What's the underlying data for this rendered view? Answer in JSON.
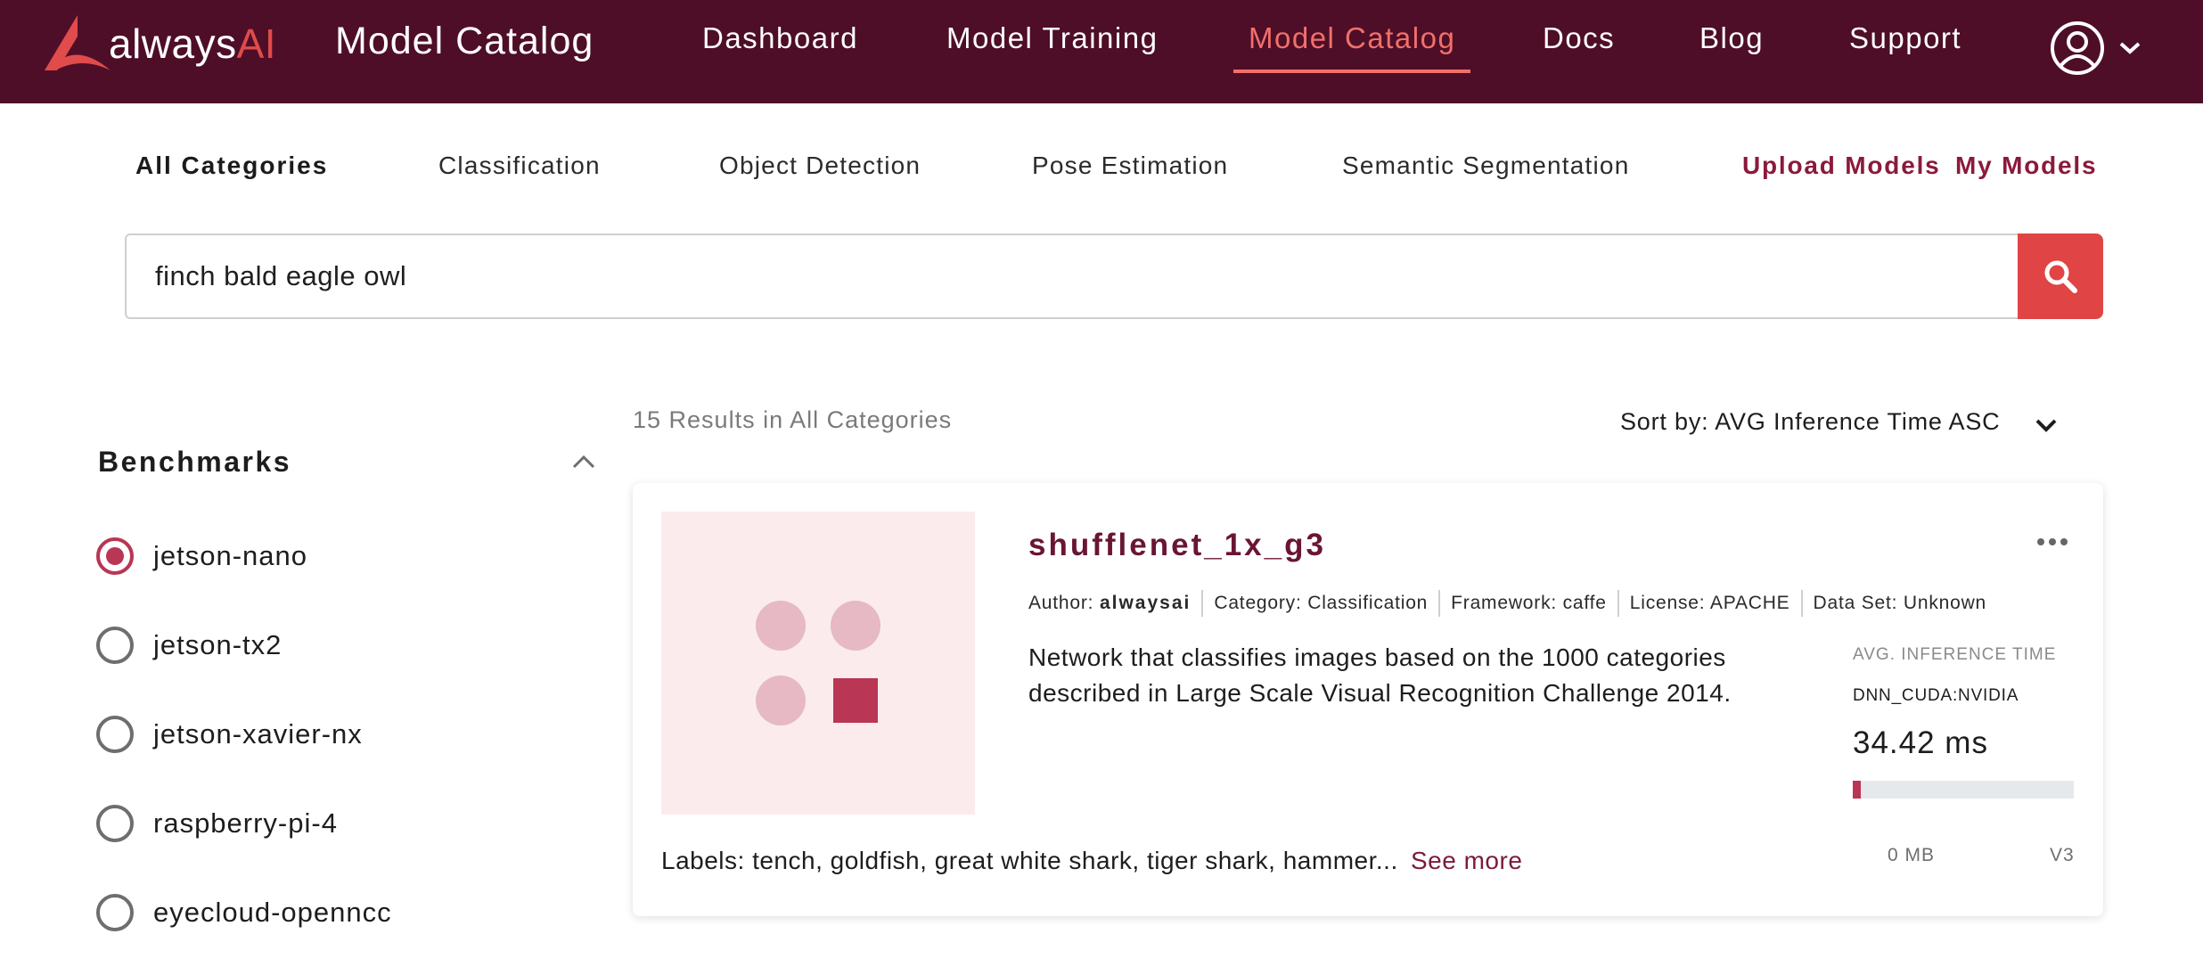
{
  "brand": {
    "name_main": "always",
    "name_accent": "AI"
  },
  "header": {
    "title": "Model Catalog",
    "nav": [
      "Dashboard",
      "Model Training",
      "Model Catalog",
      "Docs",
      "Blog",
      "Support"
    ],
    "active_nav": "Model Catalog"
  },
  "categories": {
    "items": [
      "All Categories",
      "Classification",
      "Object Detection",
      "Pose Estimation",
      "Semantic Segmentation"
    ],
    "active": "All Categories",
    "upload_label": "Upload Models",
    "my_models_label": "My Models"
  },
  "search": {
    "value": "finch bald eagle owl"
  },
  "sidebar": {
    "title": "Benchmarks",
    "options": [
      "jetson-nano",
      "jetson-tx2",
      "jetson-xavier-nx",
      "raspberry-pi-4",
      "eyecloud-openncc"
    ],
    "selected": "jetson-nano"
  },
  "results": {
    "count_text": "15 Results in All Categories",
    "sort_text": "Sort by: AVG Inference Time ASC"
  },
  "model_card": {
    "name": "shufflenet_1x_g3",
    "author_label": "Author:",
    "author": "alwaysai",
    "category": "Category: Classification",
    "framework": "Framework: caffe",
    "license": "License: APACHE",
    "dataset": "Data Set: Unknown",
    "description": "Network that classifies images based on the 1000 categories described in Large Scale Visual Recognition Challenge 2014.",
    "perf_label": "AVG. INFERENCE TIME",
    "perf_engine": "DNN_CUDA:NVIDIA",
    "perf_time": "34.42 ms",
    "perf_fraction": 0.035,
    "labels_text": "Labels: tench, goldfish, great white shark, tiger shark, hammer...",
    "see_more": "See more",
    "size": "0 MB",
    "version": "V3"
  },
  "colors": {
    "header_bg": "#4e0e27",
    "accent": "#e04444",
    "active_nav": "#f0706a",
    "brand_dark": "#6a1535",
    "radio_selected": "#b93655"
  }
}
